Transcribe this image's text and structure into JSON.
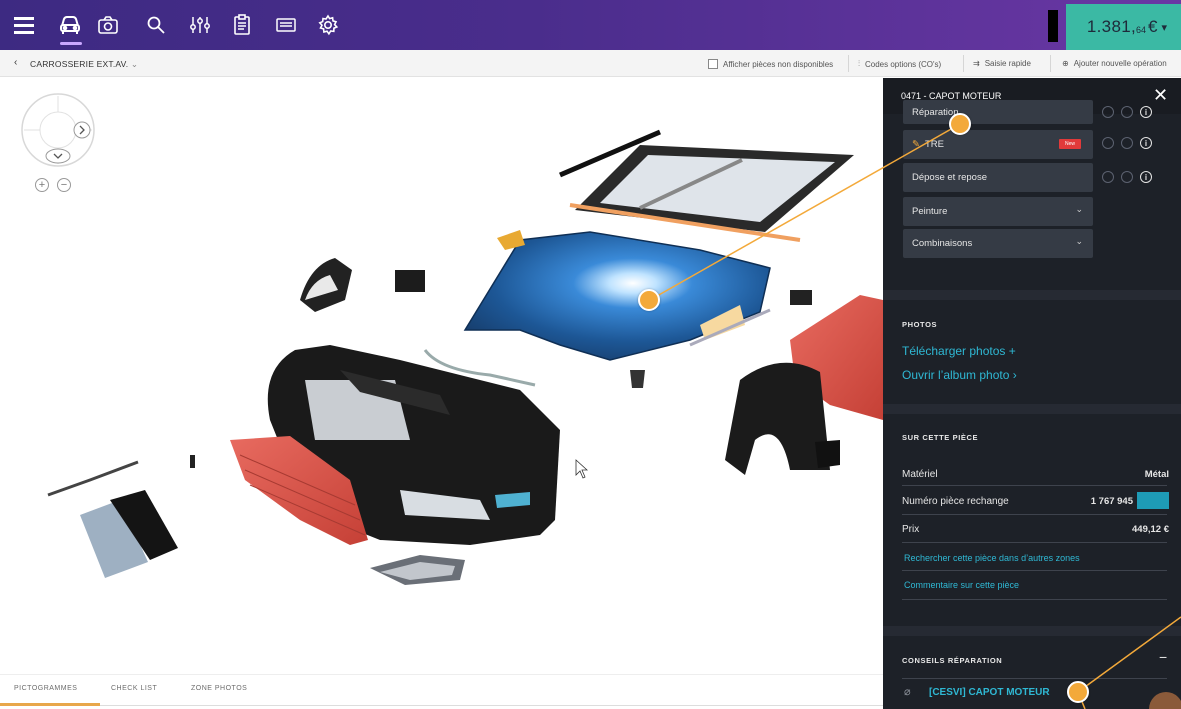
{
  "topbar": {
    "icons": [
      "menu-icon",
      "car-icon",
      "camera-icon",
      "search-icon",
      "equalizer-icon",
      "clipboard-icon",
      "keyboard-icon",
      "gear-icon"
    ],
    "price": {
      "main": "1.381,",
      "cents": "64",
      "currency": "€"
    }
  },
  "subbar": {
    "title": "CARROSSERIE EXT.AV.",
    "show_unavailable": "Afficher pièces non disponibles",
    "option_codes": "Codes options (CO's)",
    "quick_entry": "Saisie rapide",
    "add_operation": "Ajouter nouvelle opération"
  },
  "tabs": [
    "PICTOGRAMMES",
    "CHECK LIST",
    "ZONE PHOTOS"
  ],
  "panel": {
    "title": "0471 - CAPOT MOTEUR",
    "operations": [
      {
        "label": "Réparation"
      },
      {
        "label": "TRE",
        "badge": "New"
      },
      {
        "label": "Dépose et repose"
      },
      {
        "label": "Peinture"
      },
      {
        "label": "Combinaisons"
      }
    ],
    "photos": {
      "title": "PHOTOS",
      "upload": "Télécharger photos +",
      "album": "Ouvrir l’album photo ›"
    },
    "part": {
      "title": "SUR CETTE PIÈCE",
      "material_label": "Matériel",
      "material_value": "Métal",
      "ref_label": "Numéro pièce rechange",
      "ref_value": "1 767 945",
      "price_label": "Prix",
      "price_value": "449,12 €",
      "search_link": "Rechercher cette pièce dans d’autres zones",
      "comment_link": "Commentaire sur cette pièce"
    },
    "advice": {
      "title": "CONSEILS RÉPARATION",
      "link": "[CESVI] CAPOT MOTEUR"
    }
  },
  "colors": {
    "topbar_start": "#3d2a82",
    "topbar_end": "#6a37a4",
    "price_bg": "#3bb9a4",
    "panel_bg": "#1d2128",
    "link": "#2fb8d4",
    "hotspot": "#f3a93a",
    "hood": "#1f5b9c",
    "red_part": "#d9584f"
  }
}
